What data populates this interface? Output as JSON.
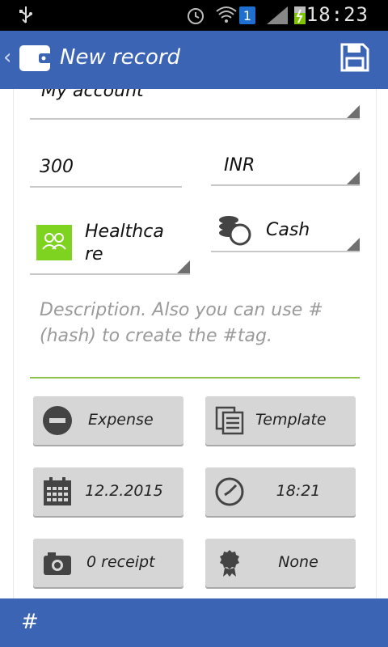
{
  "status_bar": {
    "time": "18:23",
    "notification_badge": "1"
  },
  "header": {
    "title": "New record"
  },
  "form": {
    "account": "My account",
    "amount": "300",
    "currency": "INR",
    "category_line1": "Healthca",
    "category_line2": "re",
    "payment_type": "Cash",
    "description_placeholder_line1": "Description. Also you can use #",
    "description_placeholder_line2": "(hash) to create the #tag."
  },
  "buttons": {
    "type": "Expense",
    "template": "Template",
    "date": "12.2.2015",
    "time": "18:21",
    "receipt": "0 receipt",
    "warranty": "None"
  },
  "bottom_bar": {
    "hashtag_label": "#"
  },
  "colors": {
    "action_bar": "#3c64b4",
    "category_icon": "#7ed321",
    "description_underline": "#8bc34a"
  }
}
